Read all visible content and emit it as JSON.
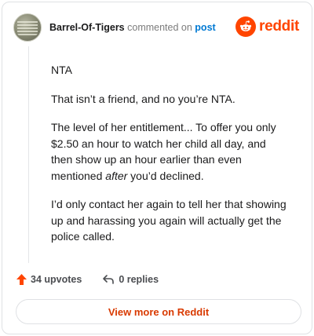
{
  "header": {
    "username": "Barrel-Of-Tigers",
    "action_text": "commented on",
    "post_link": "post",
    "logo_text": "reddit"
  },
  "comment": {
    "paragraph_1": "NTA",
    "paragraph_2": "That isn’t a friend, and no you’re NTA.",
    "paragraph_3_main": "The level of her entitlement... To offer you only $2.50 an hour to watch her child all day, and then show up an hour earlier than even mentioned ",
    "paragraph_3_emphasis": "after",
    "paragraph_3_end": " you’d declined.",
    "paragraph_4": "I’d only contact her again to tell her that showing up and harassing you again will actually get the police called."
  },
  "footer": {
    "upvotes": "34 upvotes",
    "replies": "0 replies",
    "view_more": "View more on Reddit"
  },
  "colors": {
    "brand": "#ff4500",
    "link": "#0079d3",
    "button_text": "#d93a00"
  },
  "icons": {
    "avatar": "avatar",
    "logo": "reddit-alien-icon",
    "upvote": "upvote-arrow-icon",
    "reply": "reply-arrow-icon"
  }
}
